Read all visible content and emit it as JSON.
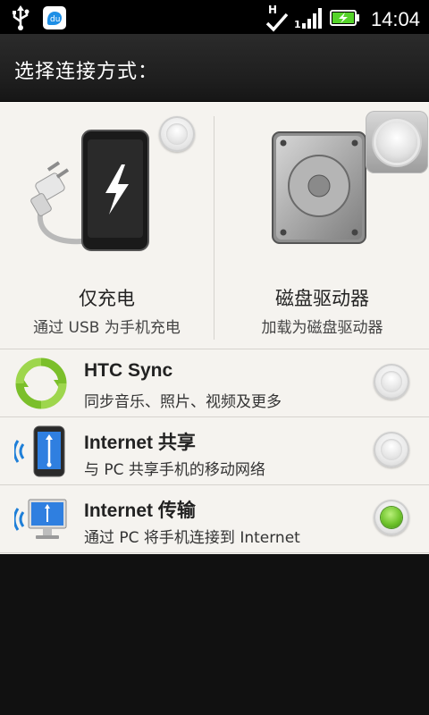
{
  "status_bar": {
    "time": "14:04",
    "network_letter": "H",
    "network_digit": "1",
    "left_icons": [
      "usb-icon",
      "baidu-app-icon"
    ],
    "right_icons": [
      "data-sync-check-icon",
      "signal-icon",
      "battery-charging-icon"
    ]
  },
  "header": {
    "title": "选择连接方式："
  },
  "modes": [
    {
      "id": "charge",
      "title": "仅充电",
      "subtitle": "通过 USB 为手机充电",
      "selected": false
    },
    {
      "id": "disk",
      "title": "磁盘驱动器",
      "subtitle": "加载为磁盘驱动器",
      "selected": false
    }
  ],
  "options": [
    {
      "id": "htc-sync",
      "title": "HTC Sync",
      "subtitle": "同步音乐、照片、视频及更多",
      "selected": false
    },
    {
      "id": "internet-sharing",
      "title": "Internet 共享",
      "subtitle": "与 PC 共享手机的移动网络",
      "selected": false
    },
    {
      "id": "internet-pass",
      "title": "Internet 传输",
      "subtitle": "通过 PC 将手机连接到 Internet",
      "selected": true
    }
  ],
  "colors": {
    "selected_green": "#6fc32c",
    "panel_bg": "#f5f3ef",
    "battery_green": "#55d32a"
  }
}
